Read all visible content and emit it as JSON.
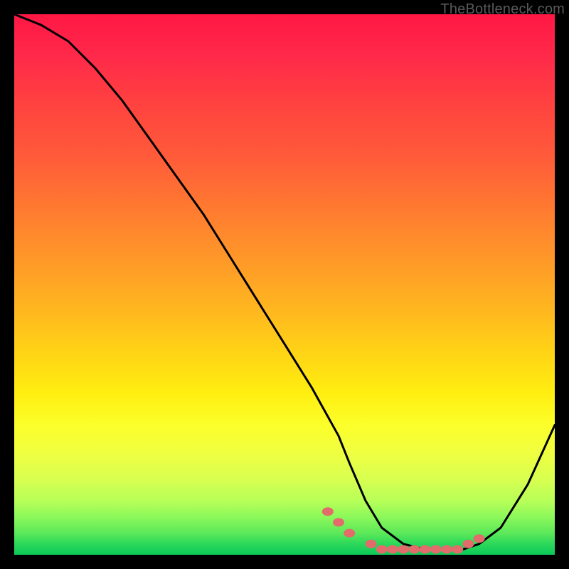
{
  "watermark": "TheBottleneck.com",
  "chart_data": {
    "type": "line",
    "title": "",
    "xlabel": "",
    "ylabel": "",
    "xlim": [
      0,
      100
    ],
    "ylim": [
      0,
      100
    ],
    "series": [
      {
        "name": "bottleneck-curve",
        "x": [
          0,
          5,
          10,
          15,
          20,
          25,
          30,
          35,
          40,
          45,
          50,
          55,
          60,
          62,
          65,
          68,
          72,
          76,
          80,
          83,
          86,
          90,
          95,
          100
        ],
        "values": [
          100,
          98,
          95,
          90,
          84,
          77,
          70,
          63,
          55,
          47,
          39,
          31,
          22,
          17,
          10,
          5,
          2,
          1,
          1,
          1,
          2,
          5,
          13,
          24
        ]
      }
    ],
    "markers": {
      "name": "highlight-dots",
      "color": "#e26b6b",
      "x": [
        58,
        60,
        62,
        66,
        68,
        70,
        72,
        74,
        76,
        78,
        80,
        82,
        84,
        86
      ],
      "values": [
        8,
        6,
        4,
        2,
        1,
        1,
        1,
        1,
        1,
        1,
        1,
        1,
        2,
        3
      ]
    }
  }
}
